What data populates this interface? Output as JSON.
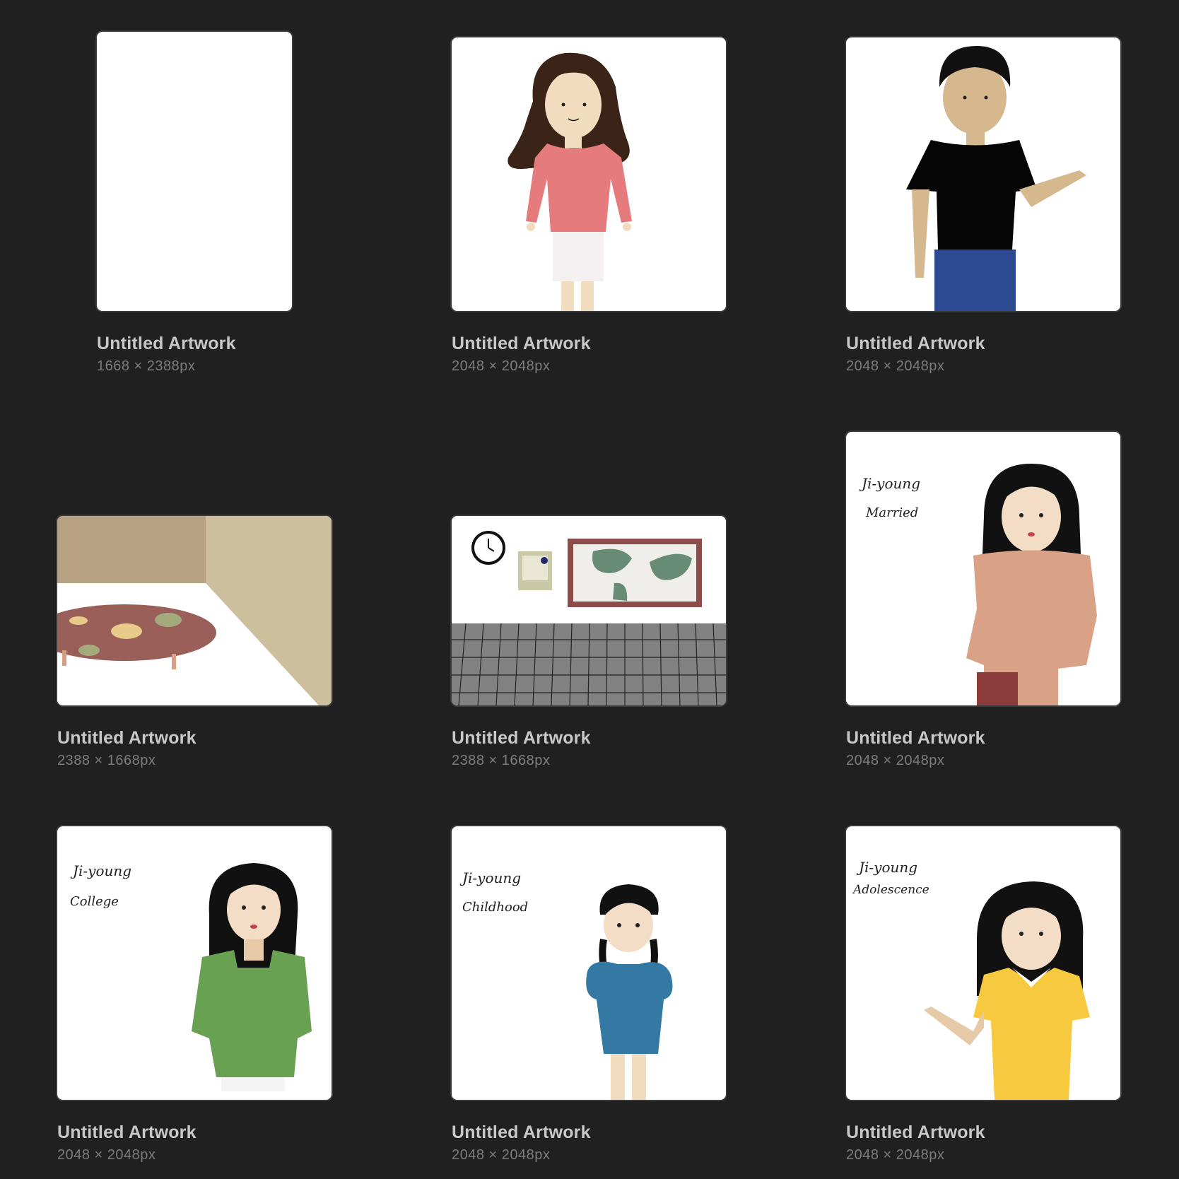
{
  "gallery": {
    "items": [
      {
        "title": "Untitled Artwork",
        "size": "1668 × 2388px"
      },
      {
        "title": "Untitled Artwork",
        "size": "2048 × 2048px"
      },
      {
        "title": "Untitled Artwork",
        "size": "2048 × 2048px"
      },
      {
        "title": "Untitled Artwork",
        "size": "2388 × 1668px"
      },
      {
        "title": "Untitled Artwork",
        "size": "2388 × 1668px"
      },
      {
        "title": "Untitled Artwork",
        "size": "2048 × 2048px",
        "handwriting": [
          "Ji-young",
          "Married"
        ]
      },
      {
        "title": "Untitled Artwork",
        "size": "2048 × 2048px",
        "handwriting": [
          "Ji-young",
          "College"
        ]
      },
      {
        "title": "Untitled Artwork",
        "size": "2048 × 2048px",
        "handwriting": [
          "Ji-young",
          "Childhood"
        ]
      },
      {
        "title": "Untitled Artwork",
        "size": "2048 × 2048px",
        "handwriting": [
          "Ji-young",
          "Adolescence"
        ]
      }
    ]
  }
}
